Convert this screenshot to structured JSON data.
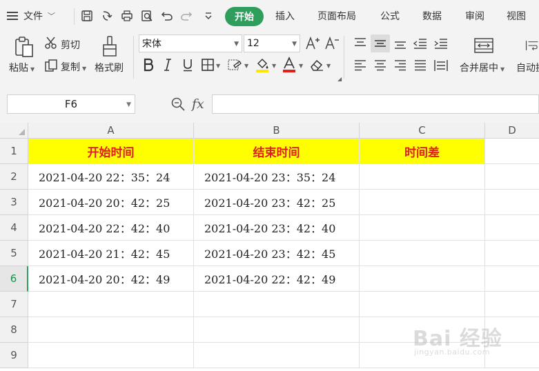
{
  "menu": {
    "file_label": "文件",
    "tabs": [
      {
        "label": "开始",
        "active": true
      },
      {
        "label": "插入"
      },
      {
        "label": "页面布局"
      },
      {
        "label": "公式"
      },
      {
        "label": "数据"
      },
      {
        "label": "审阅"
      },
      {
        "label": "视图"
      }
    ]
  },
  "ribbon": {
    "paste_label": "粘贴",
    "cut_label": "剪切",
    "copy_label": "复制",
    "format_painter_label": "格式刷",
    "font_name": "宋体",
    "font_size": "12",
    "merge_label": "合并居中",
    "autowrap_label": "自动换"
  },
  "formula_bar": {
    "cell_ref": "F6",
    "fx_label": "fx",
    "formula": ""
  },
  "sheet": {
    "columns": [
      "A",
      "B",
      "C",
      "D"
    ],
    "rows": [
      "1",
      "2",
      "3",
      "4",
      "5",
      "6",
      "7",
      "8",
      "9"
    ],
    "active_row": "6",
    "header": [
      "开始时间",
      "结束时间",
      "时间差"
    ],
    "data": [
      [
        "2021-04-20 22：35：24",
        "2021-04-20 23：35：24",
        ""
      ],
      [
        "2021-04-20 20：42：25",
        "2021-04-20 23：42：25",
        ""
      ],
      [
        "2021-04-20 22：42：40",
        "2021-04-20 23：42：40",
        ""
      ],
      [
        "2021-04-20 21：42：45",
        "2021-04-20 23：42：45",
        ""
      ],
      [
        "2021-04-20 20：42：49",
        "2021-04-20 22：42：49",
        ""
      ]
    ],
    "header_fill": "#ffff00",
    "header_text_color": "#e0201c"
  },
  "watermark": {
    "big": "Bai 经验",
    "small": "jingyan.baidu.com"
  },
  "colors": {
    "accent": "#2f9d5b"
  }
}
